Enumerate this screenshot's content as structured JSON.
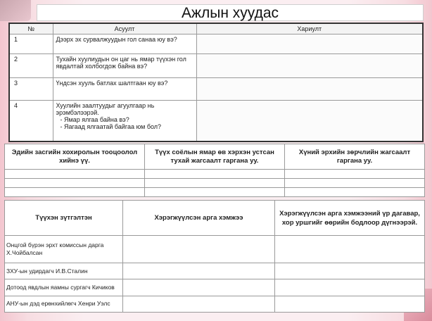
{
  "slide": {
    "title": "Ажлын хуудас"
  },
  "table1": {
    "headers": [
      "№",
      "Асуулт",
      "Хариулт"
    ],
    "rows": [
      {
        "num": "1",
        "question": "Дээрх эх сурвалжуудын гол санаа юу вэ?",
        "subs": []
      },
      {
        "num": "2",
        "question": "Тухайн хуулиудын он цаг нь ямар түүхэн гол явдалтай холбогдож байна вэ?",
        "subs": []
      },
      {
        "num": "3",
        "question": "Үндсэн хууль батлах шалтгаан юу вэ?",
        "subs": []
      },
      {
        "num": "4",
        "question": "Хуулийн заалтуудыг агуулгаар нь эрэмбэлээрэй.",
        "subs": [
          "-    Ямар ялгаа байна вэ?",
          "-    Яагаад ялгаатай байгаа юм бол?"
        ]
      }
    ]
  },
  "table2": {
    "headers": [
      "Эдийн засгийн хохиролын тооцоолол хийнэ үү.",
      "Түүх соёлын ямар өв хэрхэн устсан тухай  жагсаалт гаргана уу.",
      "Хүний эрхийн зөрчлийн жагсаалт гаргана уу."
    ]
  },
  "table3": {
    "headers": [
      "Түүхэн зүтгэлтэн",
      "Хэрэгжүүлсэн арга хэмжээ",
      "Хэрэгжүүлсэн арга хэмжээний үр дагавар, хор уршгийг өөрийн бодлоор дүгнээрэй."
    ],
    "rows": [
      "Онцгой бүрэн эрхт комиссын дарга Х.Чойбалсан",
      "ЗХУ-ын удирдагч И.В.Сталин",
      "Дотоод явдлын яамны сургагч Кичиков",
      "АНУ-ын дэд ерөнхийлөгч Хенри Уэлс"
    ]
  }
}
